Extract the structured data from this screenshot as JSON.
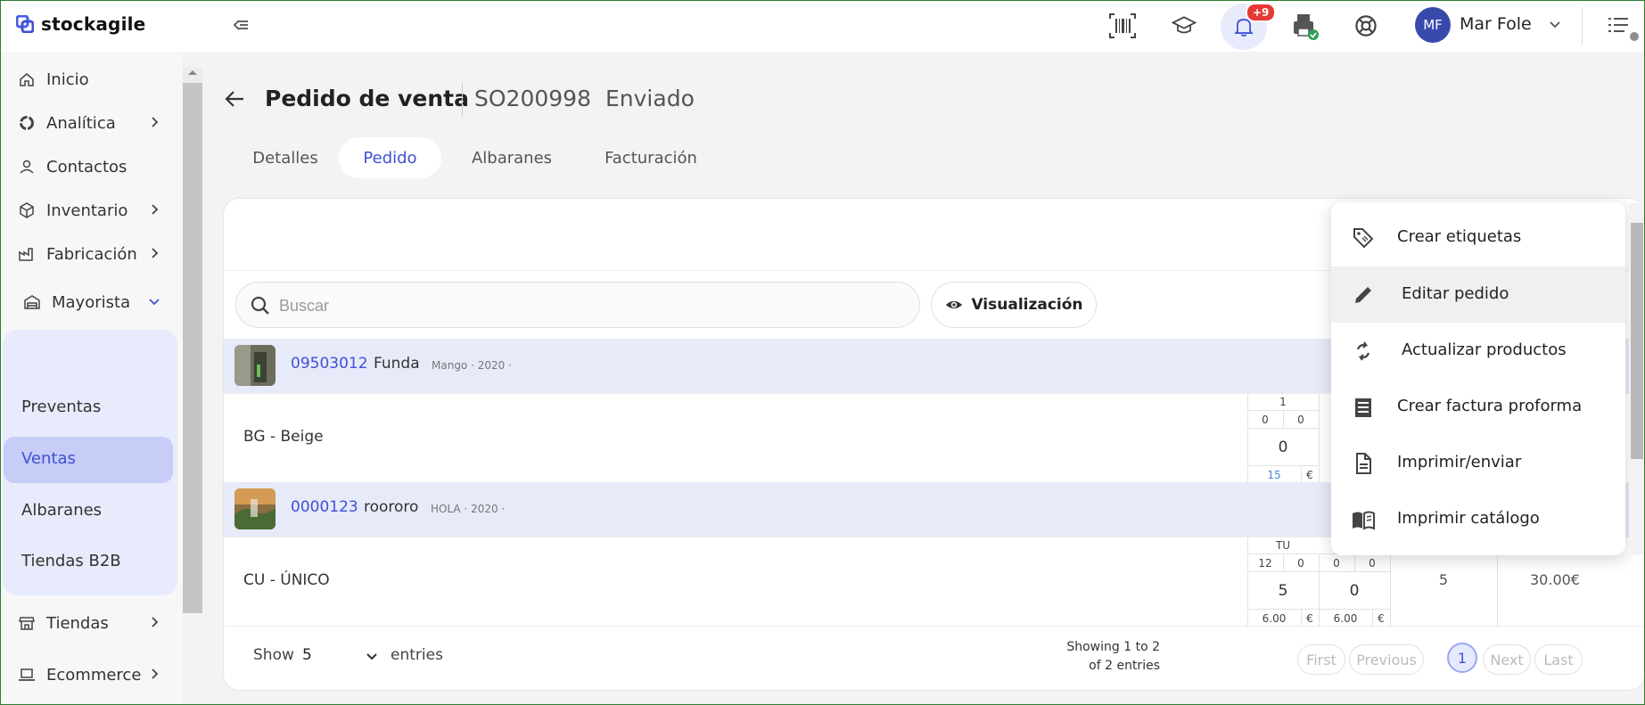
{
  "brand": {
    "name": "stockagile"
  },
  "topbar": {
    "notification_badge": "+9",
    "user_initials": "MF",
    "user_name": "Mar Fole"
  },
  "sidebar": {
    "items": [
      {
        "label": "Inicio",
        "icon": "home-icon"
      },
      {
        "label": "Analítica",
        "icon": "analytics-icon"
      },
      {
        "label": "Contactos",
        "icon": "user-icon"
      },
      {
        "label": "Inventario",
        "icon": "box-icon"
      },
      {
        "label": "Fabricación",
        "icon": "factory-icon"
      },
      {
        "label": "Mayorista",
        "icon": "warehouse-icon"
      },
      {
        "label": "Tiendas",
        "icon": "store-icon"
      },
      {
        "label": "Ecommerce",
        "icon": "laptop-icon"
      }
    ],
    "sub_items": [
      {
        "label": "Preventas"
      },
      {
        "label": "Ventas"
      },
      {
        "label": "Albaranes"
      },
      {
        "label": "Tiendas B2B"
      }
    ]
  },
  "header": {
    "title": "Pedido de venta",
    "order_ref": "SO200998",
    "status": "Enviado"
  },
  "tabs": [
    {
      "label": "Detalles"
    },
    {
      "label": "Pedido"
    },
    {
      "label": "Albaranes"
    },
    {
      "label": "Facturación"
    }
  ],
  "search": {
    "placeholder": "Buscar"
  },
  "visualization_button": {
    "label": "Visualización"
  },
  "products": [
    {
      "code": "09503012",
      "name": "Funda",
      "meta": "Mango · 2020 ·",
      "variant": "BG - Beige",
      "size_header": "1",
      "sub_values": [
        "0",
        "0"
      ],
      "qty": "0",
      "price": "15",
      "currency": "€"
    },
    {
      "code": "0000123",
      "name": "roororo",
      "meta": "HOLA · 2020 ·",
      "variant": "CU - ÚNICO",
      "size_header": "TU",
      "sub_values": [
        "12",
        "0",
        "0",
        "0"
      ],
      "qty_a": "5",
      "qty_b": "0",
      "price_a": "6.00",
      "price_b": "6.00",
      "currency": "€",
      "total_qty": "5",
      "total_amount": "30.00€"
    }
  ],
  "footer": {
    "show_label": "Show",
    "show_value": "5",
    "entries_label": "entries",
    "showing_line1": "Showing 1 to 2",
    "showing_line2": "of 2 entries",
    "pagination": {
      "first": "First",
      "previous": "Previous",
      "current": "1",
      "next": "Next",
      "last": "Last"
    }
  },
  "dropdown": {
    "items": [
      {
        "label": "Crear etiquetas",
        "icon": "tag-icon"
      },
      {
        "label": "Editar pedido",
        "icon": "pencil-icon"
      },
      {
        "label": "Actualizar productos",
        "icon": "refresh-icon"
      },
      {
        "label": "Crear factura proforma",
        "icon": "invoice-icon"
      },
      {
        "label": "Imprimir/enviar",
        "icon": "document-icon"
      },
      {
        "label": "Imprimir catálogo",
        "icon": "book-icon"
      }
    ]
  },
  "colors": {
    "accent": "#3f51d5",
    "product_row_bg": "#e7eaf9",
    "badge": "#e53935",
    "avatar": "#3949ab"
  }
}
